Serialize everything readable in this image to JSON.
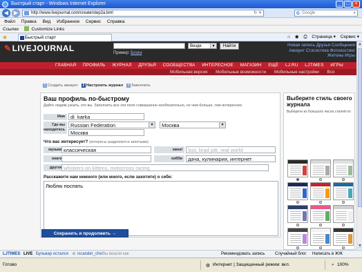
{
  "window": {
    "title": "Быстрый старт - Windows Internet Explorer",
    "address": "http://www.livejournal.com/create/step2a.bml",
    "search_placeholder": "Google"
  },
  "menu": [
    "Файл",
    "Правка",
    "Вид",
    "Избранное",
    "Сервис",
    "Справка"
  ],
  "links_bar": {
    "label": "Ссылки",
    "item": "Customize Links"
  },
  "tab": {
    "title": "Быстрый старт"
  },
  "commands": [
    "Страница ▾",
    "Сервис ▾"
  ],
  "lj": {
    "logo": "LIVEJOURNAL",
    "search_scope": "Везде",
    "search_button": "Найти",
    "example_label": "Пример:",
    "example_link": "Блоги",
    "toplinks_line1": "Новая запись  Друзья  Сообщения",
    "toplinks_line2": "Аккаунт  Статистика  Фотохостинг",
    "toplinks_line3": "Жетоны  Игры",
    "nav": [
      "ГЛАВНАЯ",
      "ПРОФИЛЬ",
      "ЖУРНАЛ",
      "ДРУЗЬЯ",
      "СООБЩЕСТВА",
      "ИНТЕРЕСНОЕ",
      "МАГАЗИН",
      "ЕЩЁ",
      "LJ.RU",
      "LJTIMES",
      "ИГРЫ"
    ],
    "subnav": [
      "Мобильная версия",
      "Мобильные возможности",
      "Мобильные настройки",
      "Вся статистика ЖЖ"
    ]
  },
  "steps": [
    {
      "num": "1",
      "label": "Создать аккаунт"
    },
    {
      "num": "2",
      "label": "Настроить журнал"
    },
    {
      "num": "3",
      "label": "Закончить"
    }
  ],
  "form": {
    "title": "Ваш профиль по-быстрому",
    "intro": "Дайте людям узнать, кто вы. Заполнять все эти поля совершенно необязательно, но чем больше, тем интереснее.",
    "name_label": "Имя",
    "name_value": "di_karka",
    "location_label": "Где вы находитесь",
    "country_value": "Russian Federation",
    "region_value": "Москва",
    "city_value": "Москва",
    "interests_heading": "Что вас интересует?",
    "interests_hint": "(интересы разделяются запятыми)",
    "music_label": "музыка",
    "music_value": "классическая",
    "films_label": "кино/телевидение",
    "films_placeholder": "lost, brad pitt, real world",
    "books_label": "книги",
    "books_value": "",
    "hobby_label": "хобби",
    "hobby_value": "дача, кулинария, интернет",
    "other_label": "другое",
    "other_placeholder": "whiskers on kittens, motocross racing",
    "about_heading": "Расскажите нам немного (или много, если захотите) о себе:",
    "about_value": "Люблю поспать",
    "submit": "Сохранить и продолжить →"
  },
  "style_picker": {
    "title": "Выберите стиль своего журнала",
    "note": "Выберите из большого числа стилей по",
    "thumbs": [
      {
        "band": "#2b2b2b",
        "side": "#c44"
      },
      {
        "band": "#d9d9d9",
        "side": "#aaa"
      },
      {
        "band": "#e0e0e0",
        "side": "#9b9"
      },
      {
        "band": "#1a2a55",
        "side": "#36c"
      },
      {
        "band": "#c4242e",
        "side": "#f90"
      },
      {
        "band": "#1e6b9a",
        "side": "#4ab"
      },
      {
        "band": "#2c3f6b",
        "side": "#77a"
      },
      {
        "band": "#e85a8a",
        "side": "#6a6"
      },
      {
        "band": "#cfcfcf",
        "side": "#eee"
      },
      {
        "band": "#444444",
        "side": "#b8d"
      },
      {
        "band": "#f3f3f3",
        "side": "#48c"
      },
      {
        "band": "#333333",
        "side": "#d94"
      }
    ]
  },
  "lj_toolbar": {
    "brand": "LJTIMES",
    "live": "LIVE",
    "live_item": "Бульвар остался",
    "user": "iscander_che",
    "user_note": "Вы вошли как",
    "rec": "Рекомендовать запись",
    "random": "Случайный блог",
    "write": "Написать в ЖЖ"
  },
  "status": {
    "left": "Готово",
    "zone": "Интернет | Защищенный режим: вкл.",
    "zoom": "100%"
  }
}
